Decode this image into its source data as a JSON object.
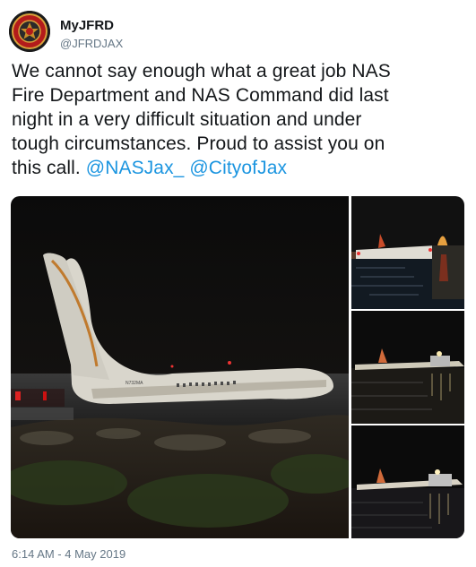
{
  "author": {
    "name": "MyJFRD",
    "handle": "@JFRDJAX"
  },
  "tweet": {
    "line1": "We cannot say enough what a great job NAS",
    "line2": "Fire Department and NAS Command did last",
    "line3": "night in a very difficult situation and under",
    "line4": "tough circumstances.  Proud to assist you on",
    "line5_prefix": "this call. ",
    "mention1": "@NASJax_",
    "mention2": "@CityofJax"
  },
  "photos": {
    "main_tail_text": "N732MA"
  },
  "timestamp": "6:14 AM - 4 May 2019",
  "colors": {
    "link": "#1b95e0",
    "text": "#14171a",
    "secondary": "#657786"
  }
}
